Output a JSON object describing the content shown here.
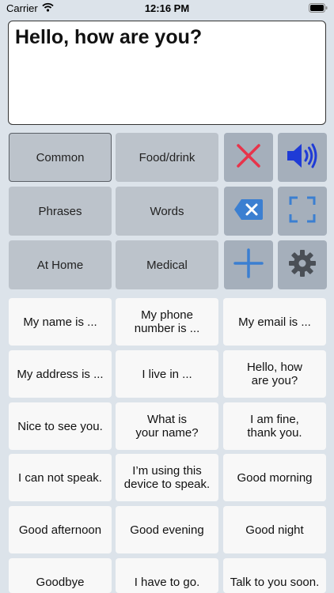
{
  "status": {
    "carrier": "Carrier",
    "time": "12:16 PM"
  },
  "text_area": {
    "value": "Hello, how are you?"
  },
  "categories": [
    "Common",
    "Food/drink",
    "Phrases",
    "Words",
    "At Home",
    "Medical"
  ],
  "selected_category": "Common",
  "tools": {
    "clear": "close-icon",
    "speak": "speaker-icon",
    "backspace": "backspace-icon",
    "fullscreen": "fullscreen-icon",
    "add": "plus-icon",
    "settings": "gear-icon"
  },
  "colors": {
    "clear": "#e8334a",
    "speak": "#1f3bd6",
    "accent": "#3b7fd1"
  },
  "phrases": [
    "My name is ...",
    "My phone\nnumber is ...",
    "My email is ...",
    "My address is ...",
    "I live in ...",
    "Hello, how\nare you?",
    "Nice to see you.",
    "What is\nyour name?",
    "I am fine,\nthank you.",
    "I can not speak.",
    "I’m using this\ndevice to speak.",
    "Good morning",
    "Good afternoon",
    "Good evening",
    "Good night",
    "Goodbye",
    "I have to go.",
    "Talk to you soon."
  ]
}
